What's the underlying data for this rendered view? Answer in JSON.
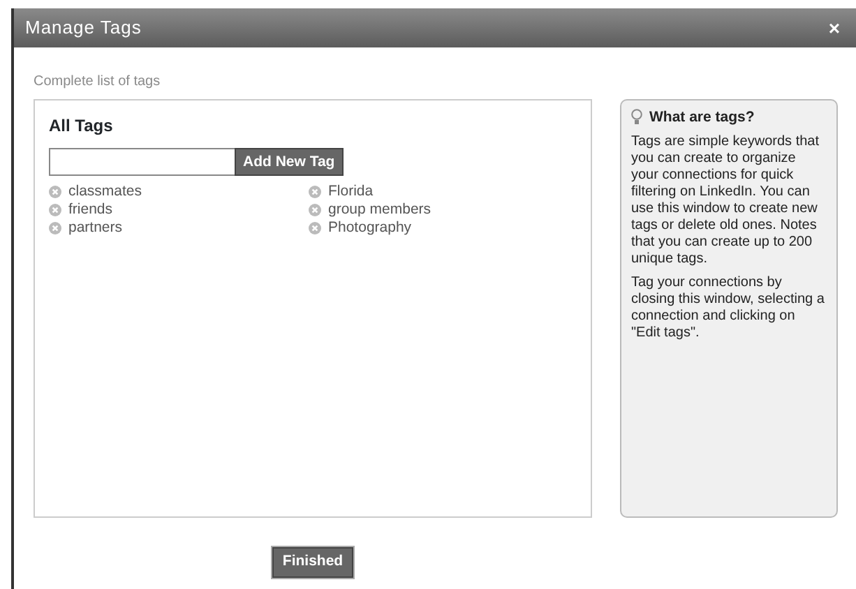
{
  "window": {
    "title": "Manage Tags",
    "close": "×"
  },
  "subtitle": "Complete list of tags",
  "tags_panel": {
    "heading": "All Tags",
    "add_button": "Add New Tag",
    "tags": [
      {
        "label": "classmates"
      },
      {
        "label": "friends"
      },
      {
        "label": "partners"
      },
      {
        "label": "Florida"
      },
      {
        "label": "group members"
      },
      {
        "label": "Photography"
      }
    ]
  },
  "help": {
    "title": "What are tags?",
    "paragraphs": [
      "Tags are simple keywords that you can create to organize your connections for quick filtering on LinkedIn. You can use this window to create new tags or delete old ones. Notes that you can create up to 200 unique tags.",
      "Tag your connections by closing this window, selecting a connection and clicking on \"Edit tags\"."
    ]
  },
  "finish_button": "Finished"
}
